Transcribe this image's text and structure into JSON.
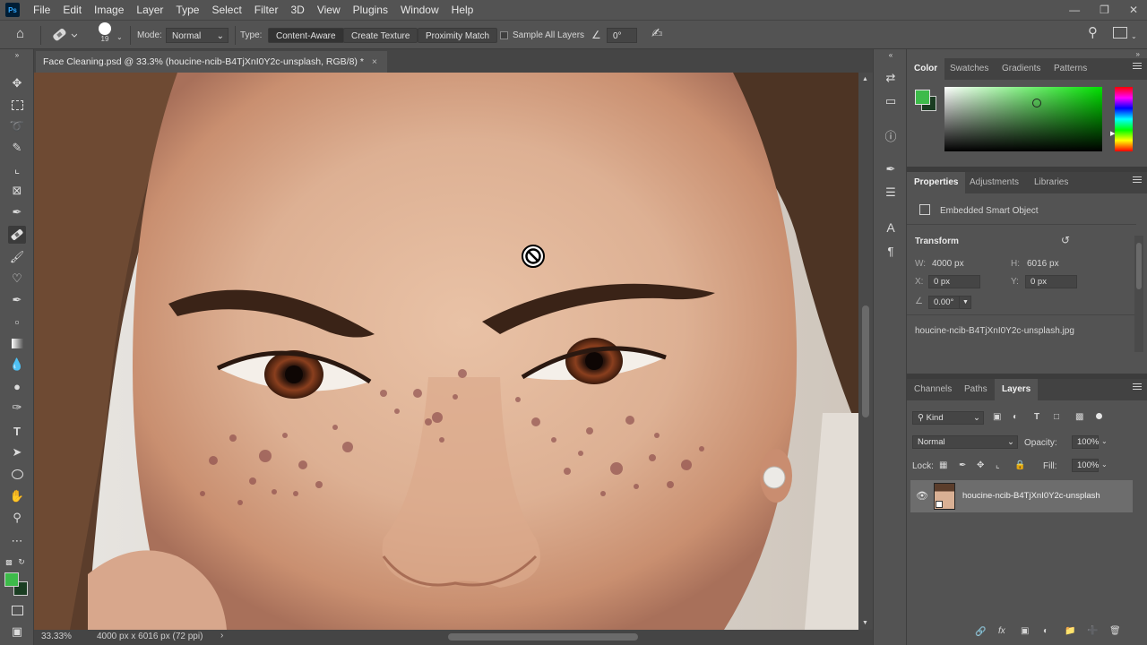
{
  "menubar": {
    "logo": "Ps",
    "items": [
      "File",
      "Edit",
      "Image",
      "Layer",
      "Type",
      "Select",
      "Filter",
      "3D",
      "View",
      "Plugins",
      "Window",
      "Help"
    ]
  },
  "options": {
    "brush_size": "19",
    "mode_label": "Mode:",
    "mode_value": "Normal",
    "type_label": "Type:",
    "type_content_aware": "Content-Aware",
    "type_create_texture": "Create Texture",
    "type_proximity_match": "Proximity Match",
    "sample_all_layers": "Sample All Layers",
    "angle_value": "0°"
  },
  "document": {
    "tab_title": "Face Cleaning.psd @ 33.3% (houcine-ncib-B4TjXnI0Y2c-unsplash, RGB/8) *",
    "close": "×"
  },
  "status": {
    "zoom": "33.33%",
    "dimensions": "4000 px x 6016 px (72 ppi)",
    "arrow": "›"
  },
  "color_panel": {
    "tabs": [
      "Color",
      "Swatches",
      "Gradients",
      "Patterns"
    ],
    "foreground": "#3dbb4a",
    "background": "#1a3d22"
  },
  "properties_panel": {
    "tabs": [
      "Properties",
      "Adjustments",
      "Libraries"
    ],
    "object_type": "Embedded Smart Object",
    "transform_label": "Transform",
    "w_label": "W:",
    "w_value": "4000 px",
    "h_label": "H:",
    "h_value": "6016 px",
    "x_label": "X:",
    "x_value": "0 px",
    "y_label": "Y:",
    "y_value": "0 px",
    "angle_value": "0.00°",
    "filename": "houcine-ncib-B4TjXnI0Y2c-unsplash.jpg"
  },
  "layers_panel": {
    "tabs": [
      "Channels",
      "Paths",
      "Layers"
    ],
    "kind_label": "Kind",
    "blend_mode": "Normal",
    "opacity_label": "Opacity:",
    "opacity_value": "100%",
    "lock_label": "Lock:",
    "fill_label": "Fill:",
    "fill_value": "100%",
    "layer_name": "houcine-ncib-B4TjXnI0Y2c-unsplash"
  }
}
